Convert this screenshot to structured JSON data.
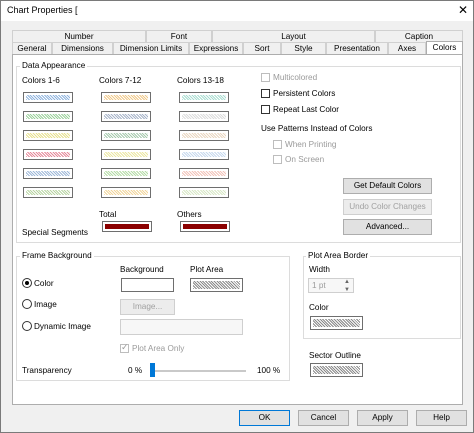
{
  "window": {
    "title": "Chart Properties [",
    "close_glyph": "✕"
  },
  "tabs": {
    "row1": [
      "Number",
      "Font",
      "Layout",
      "Caption"
    ],
    "row2": [
      "General",
      "Dimensions",
      "Dimension Limits",
      "Expressions",
      "Sort",
      "Style",
      "Presentation",
      "Axes",
      "Colors"
    ],
    "active": "Colors"
  },
  "data_appearance": {
    "title": "Data Appearance",
    "col1_label": "Colors 1-6",
    "col2_label": "Colors 7-12",
    "col3_label": "Colors 13-18",
    "col1_colors": [
      "#8fb4de",
      "#9bd19b",
      "#e6e08e",
      "#e58a9a",
      "#9fb9d9",
      "#b9d5a3"
    ],
    "col2_colors": [
      "#f0c98a",
      "#a7b4c9",
      "#a6c9ad",
      "#ebe7a2",
      "#b5dca7",
      "#f1d59b"
    ],
    "col3_colors": [
      "#a9ddd1",
      "#dcdcdc",
      "#e9d6c0",
      "#c7d9ee",
      "#f2c3b9",
      "#d8e8c6"
    ],
    "total_label": "Total",
    "others_label": "Others",
    "special_segments_label": "Special Segments",
    "total_color": "#8b0000",
    "others_color": "#8b0000"
  },
  "options": {
    "multicolored": "Multicolored",
    "persistent_colors": "Persistent Colors",
    "repeat_last_color": "Repeat Last Color",
    "use_patterns": "Use Patterns Instead of Colors",
    "when_printing": "When Printing",
    "on_screen": "On Screen"
  },
  "buttons": {
    "get_default_colors": "Get Default Colors",
    "undo_color_changes": "Undo Color Changes",
    "advanced": "Advanced...",
    "image": "Image...",
    "ok": "OK",
    "cancel": "Cancel",
    "apply": "Apply",
    "help": "Help"
  },
  "frame_background": {
    "title": "Frame Background",
    "color": "Color",
    "image": "Image",
    "dynamic_image": "Dynamic Image",
    "background_label": "Background",
    "plot_area_label": "Plot Area",
    "plot_area_only": "Plot Area Only",
    "transparency_label": "Transparency",
    "transparency_min": "0 %",
    "transparency_max": "100 %",
    "transparency_value": 0
  },
  "plot_area_border": {
    "title": "Plot Area Border",
    "width_label": "Width",
    "width_value": "1 pt",
    "color_label": "Color"
  },
  "sector_outline_label": "Sector Outline"
}
